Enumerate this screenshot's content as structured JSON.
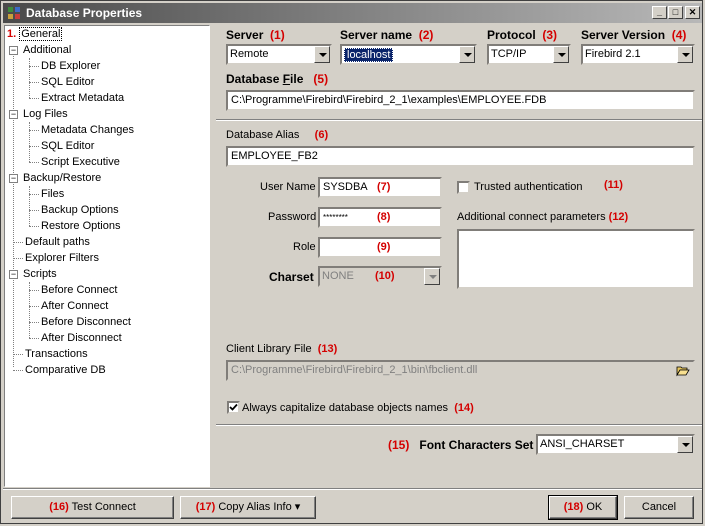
{
  "window": {
    "title": "Database Properties"
  },
  "tree": {
    "items": [
      {
        "num": "1.",
        "label": "General"
      },
      {
        "label": "Additional"
      },
      {
        "label": "DB Explorer"
      },
      {
        "label": "SQL Editor"
      },
      {
        "label": "Extract Metadata"
      },
      {
        "label": "Log Files"
      },
      {
        "label": "Metadata Changes"
      },
      {
        "label": "SQL Editor"
      },
      {
        "label": "Script Executive"
      },
      {
        "label": "Backup/Restore"
      },
      {
        "label": "Files"
      },
      {
        "label": "Backup Options"
      },
      {
        "label": "Restore Options"
      },
      {
        "label": "Default paths"
      },
      {
        "label": "Explorer Filters"
      },
      {
        "label": "Scripts"
      },
      {
        "label": "Before Connect"
      },
      {
        "label": "After Connect"
      },
      {
        "label": "Before Disconnect"
      },
      {
        "label": "After Disconnect"
      },
      {
        "label": "Transactions"
      },
      {
        "label": "Comparative DB"
      }
    ]
  },
  "form": {
    "server": {
      "label": "Server",
      "num": "(1)",
      "value": "Remote"
    },
    "server_name": {
      "label": "Server name",
      "num": "(2)",
      "value": "localhost"
    },
    "protocol": {
      "label": "Protocol",
      "num": "(3)",
      "value": "TCP/IP"
    },
    "server_version": {
      "label": "Server Version",
      "num": "(4)",
      "value": "Firebird 2.1"
    },
    "database_file": {
      "label_pre": "Database ",
      "label_u": "F",
      "label_post": "ile",
      "num": "(5)",
      "value": "C:\\Programme\\Firebird\\Firebird_2_1\\examples\\EMPLOYEE.FDB"
    },
    "database_alias": {
      "label": "Database Alias",
      "num": "(6)",
      "value": "EMPLOYEE_FB2"
    },
    "user_name": {
      "label": "User Name",
      "num": "(7)",
      "value": "SYSDBA"
    },
    "password": {
      "label": "Password",
      "num": "(8)",
      "value": "********"
    },
    "role": {
      "label": "Role",
      "num": "(9)",
      "value": ""
    },
    "charset": {
      "label": "Charset",
      "num": "(10)",
      "value": "NONE"
    },
    "trusted_auth": {
      "label": "Trusted authentication",
      "num": "(11)",
      "checked": false
    },
    "additional_params": {
      "label": "Additional connect parameters",
      "num": "(12)",
      "value": ""
    },
    "client_library": {
      "label": "Client Library File",
      "num": "(13)",
      "value": "C:\\Programme\\Firebird\\Firebird_2_1\\bin\\fbclient.dll"
    },
    "always_capitalize": {
      "label": "Always capitalize database objects names",
      "num": "(14)",
      "checked": true
    },
    "font_charset": {
      "num": "(15)",
      "label": "Font Characters Set",
      "value": "ANSI_CHARSET"
    }
  },
  "buttons": {
    "test_connect": {
      "num": "(16)",
      "label": "Test Connect"
    },
    "copy_alias": {
      "num": "(17)",
      "label": "Copy Alias Info"
    },
    "ok": {
      "num": "(18)",
      "label": "OK"
    },
    "cancel": {
      "label": "Cancel"
    }
  },
  "colors": {
    "accent_number": "#d40000",
    "selection": "#0a246a"
  }
}
